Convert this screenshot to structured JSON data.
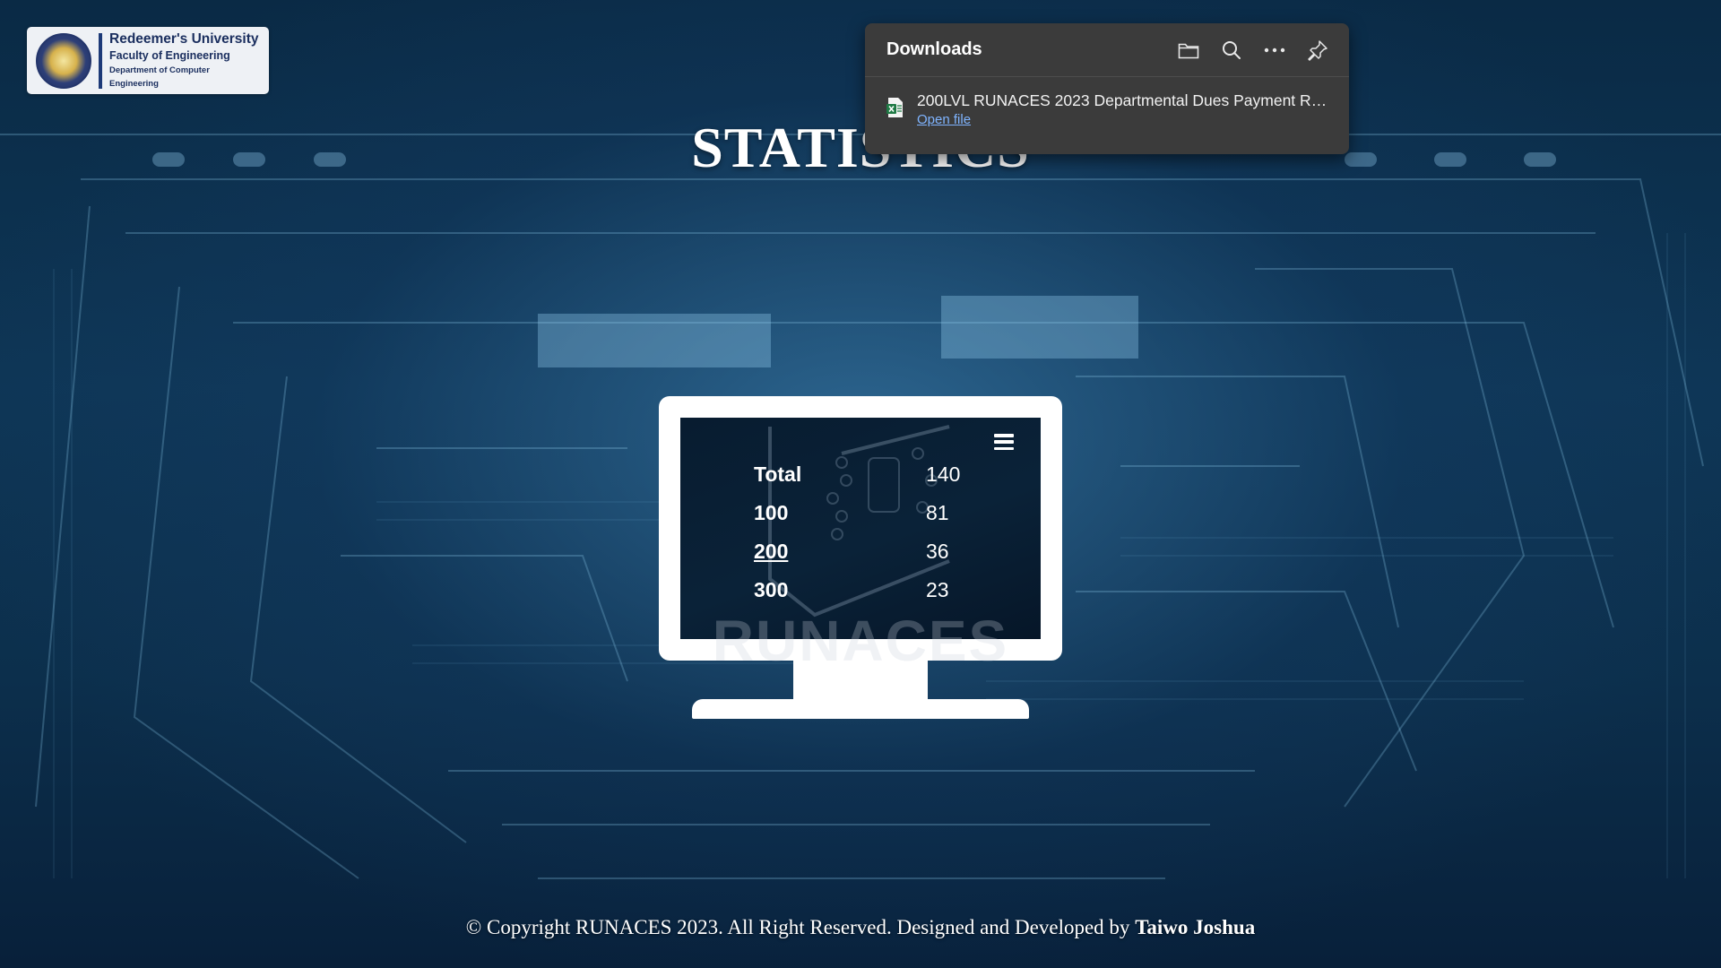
{
  "logo": {
    "university": "Redeemer's University",
    "faculty": "Faculty of Engineering",
    "department": "Department of Computer Engineering"
  },
  "page": {
    "title": "STATISTICS"
  },
  "stats": {
    "rows": [
      {
        "label": "Total",
        "value": "140"
      },
      {
        "label": "100",
        "value": "81"
      },
      {
        "label": "200",
        "value": "36"
      },
      {
        "label": "300",
        "value": "23"
      }
    ]
  },
  "watermark": "RUNACES",
  "downloads": {
    "title": "Downloads",
    "item_name": "200LVL RUNACES 2023 Departmental Dues Payment Re...",
    "open_file": "Open file",
    "icons": [
      "folder-icon",
      "search-icon",
      "more-icon",
      "pin-icon"
    ]
  },
  "footer": {
    "text": "© Copyright RUNACES 2023. All Right Reserved. Designed and Developed by ",
    "author": "Taiwo Joshua"
  },
  "colors": {
    "background": "#0b2238",
    "panel": "#3b3b3b",
    "link": "#7fb4ff"
  }
}
